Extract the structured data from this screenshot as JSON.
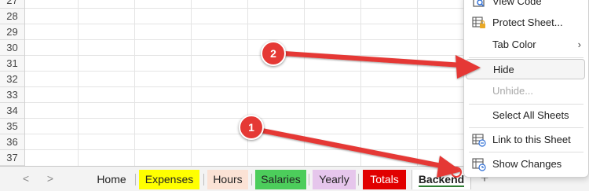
{
  "grid": {
    "row_numbers": [
      "27",
      "28",
      "29",
      "30",
      "31",
      "32",
      "33",
      "34",
      "35",
      "36",
      "37"
    ]
  },
  "tabbar": {
    "nav_prev": "<",
    "nav_next": ">",
    "add_sheet": "+",
    "tabs": [
      {
        "label": "Home",
        "color": ""
      },
      {
        "label": "Expenses",
        "color": "#ffff00"
      },
      {
        "label": "Hours",
        "color": "#fbe2d5"
      },
      {
        "label": "Salaries",
        "color": "#4ccd5b"
      },
      {
        "label": "Yearly",
        "color": "#e6c6ec"
      },
      {
        "label": "Totals",
        "color": "#e10000"
      },
      {
        "label": "Backend",
        "color": "#ffffff",
        "active": true
      }
    ]
  },
  "context_menu": {
    "items": [
      {
        "label": "View Code",
        "icon": "view-code-icon"
      },
      {
        "label": "Protect Sheet...",
        "icon": "protect-sheet-icon"
      },
      {
        "label": "Tab Color",
        "icon": "",
        "submenu": true
      },
      {
        "label": "Hide",
        "icon": "",
        "highlighted": true
      },
      {
        "label": "Unhide...",
        "icon": "",
        "disabled": true
      },
      {
        "label": "Select All Sheets",
        "icon": ""
      },
      {
        "label": "Link to this Sheet",
        "icon": "link-sheet-icon"
      },
      {
        "label": "Show Changes",
        "icon": "show-changes-icon"
      }
    ]
  },
  "annotations": {
    "badge_1": "1",
    "badge_2": "2",
    "color": "#e53935"
  }
}
